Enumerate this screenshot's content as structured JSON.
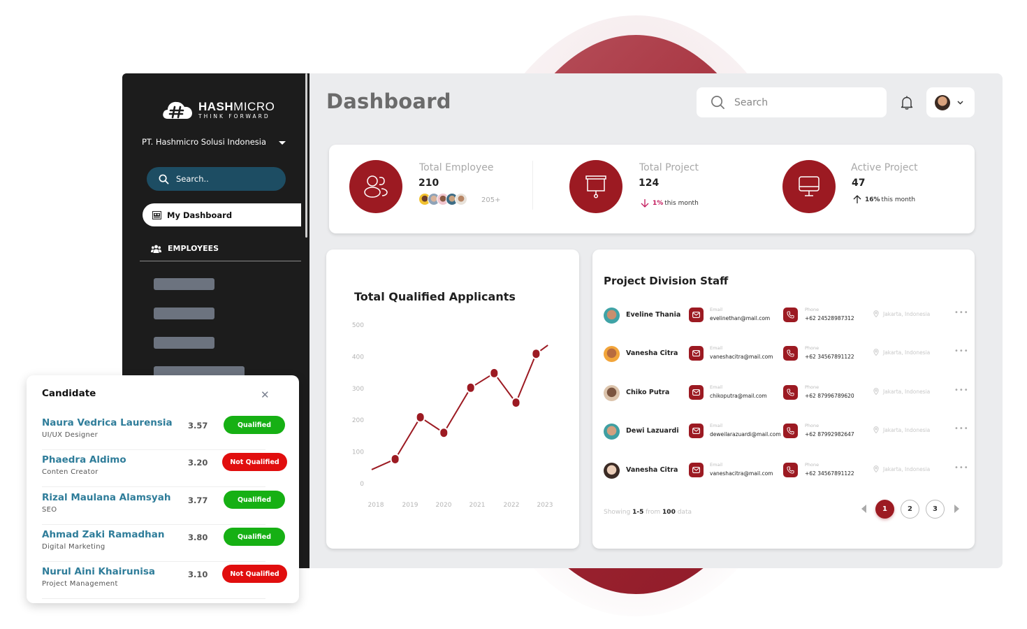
{
  "brand": {
    "name_bold": "HASH",
    "name_light": "MICRO",
    "tagline": "THINK FORWARD",
    "accent_color": "#9c1a22"
  },
  "sidebar": {
    "company": "PT. Hashmicro Solusi Indonesia",
    "search_placeholder": "Search..",
    "active_item": "My Dashboard",
    "section_label": "EMPLOYEES"
  },
  "header": {
    "title": "Dashboard",
    "search_placeholder": "Search"
  },
  "stats": [
    {
      "label": "Total Employee",
      "value": "210",
      "extra": "205+",
      "icon": "users-icon"
    },
    {
      "label": "Total Project",
      "value": "124",
      "trend_dir": "down",
      "trend_pct": "1%",
      "trend_text": "this month",
      "icon": "projector-screen-icon"
    },
    {
      "label": "Active Project",
      "value": "47",
      "trend_dir": "up",
      "trend_pct": "16%",
      "trend_text": "this month",
      "icon": "monitor-icon"
    }
  ],
  "chart_data": {
    "type": "line",
    "title": "Total Qualified Applicants",
    "xlabel": "",
    "ylabel": "",
    "x_ticks": [
      "2018",
      "2019",
      "2020",
      "2021",
      "2022",
      "2023"
    ],
    "y_ticks": [
      0,
      100,
      200,
      300,
      400,
      500
    ],
    "ylim": [
      0,
      500
    ],
    "xlim": [
      2017.85,
      2023.2
    ],
    "grid": false,
    "color": "#9c1a22",
    "series": [
      {
        "name": "Qualified Applicants",
        "x": [
          2017.85,
          2018.55,
          2019.3,
          2020.0,
          2020.8,
          2021.5,
          2022.15,
          2022.75,
          2023.1
        ],
        "values": [
          42,
          75,
          207,
          158,
          300,
          346,
          253,
          407,
          434
        ],
        "markers": [
          false,
          true,
          true,
          true,
          true,
          true,
          true,
          true,
          false
        ]
      }
    ]
  },
  "staff": {
    "title": "Project Division Staff",
    "email_label": "Email",
    "phone_label": "Phone",
    "rows": [
      {
        "name": "Eveline Thania",
        "email": "evelinethan@mail.com",
        "phone": "+62 24528987312",
        "location": "Jakarta, Indonesia"
      },
      {
        "name": "Vanesha Citra",
        "email": "vaneshacitra@mail.com",
        "phone": "+62 34567891122",
        "location": "Jakarta, Indonesia"
      },
      {
        "name": "Chiko Putra",
        "email": "chikoputra@mail.com",
        "phone": "+62 87996789620",
        "location": "Jakarta, Indonesia"
      },
      {
        "name": "Dewi Lazuardi",
        "email": "deweilarazuardi@mail.com",
        "phone": "+62 87992982647",
        "location": "Jakarta, Indonesia"
      },
      {
        "name": "Vanesha Citra",
        "email": "vaneshacitra@mail.com",
        "phone": "+62 34567891122",
        "location": "Jakarta, Indonesia"
      }
    ],
    "showing_prefix": "Showing",
    "showing_range": "1-5",
    "showing_mid": "from",
    "showing_total": "100",
    "showing_suffix": "data",
    "pages": [
      "1",
      "2",
      "3"
    ],
    "current_page": "1"
  },
  "candidate": {
    "title": "Candidate",
    "rows": [
      {
        "name": "Naura Vedrica Laurensia",
        "role": "UI/UX Designer",
        "score": "3.57",
        "status": "Qualified"
      },
      {
        "name": "Phaedra Aldimo",
        "role": "Conten Creator",
        "score": "3.20",
        "status": "Not Qualified"
      },
      {
        "name": "Rizal Maulana Alamsyah",
        "role": "SEO",
        "score": "3.77",
        "status": "Qualified"
      },
      {
        "name": "Ahmad Zaki Ramadhan",
        "role": "Digital Marketing",
        "score": "3.80",
        "status": "Qualified"
      },
      {
        "name": "Nurul Aini Khairunisa",
        "role": "Project Management",
        "score": "3.10",
        "status": "Not Qualified"
      }
    ],
    "qualified_color": "#16b014",
    "not_qualified_color": "#e10e0e"
  }
}
